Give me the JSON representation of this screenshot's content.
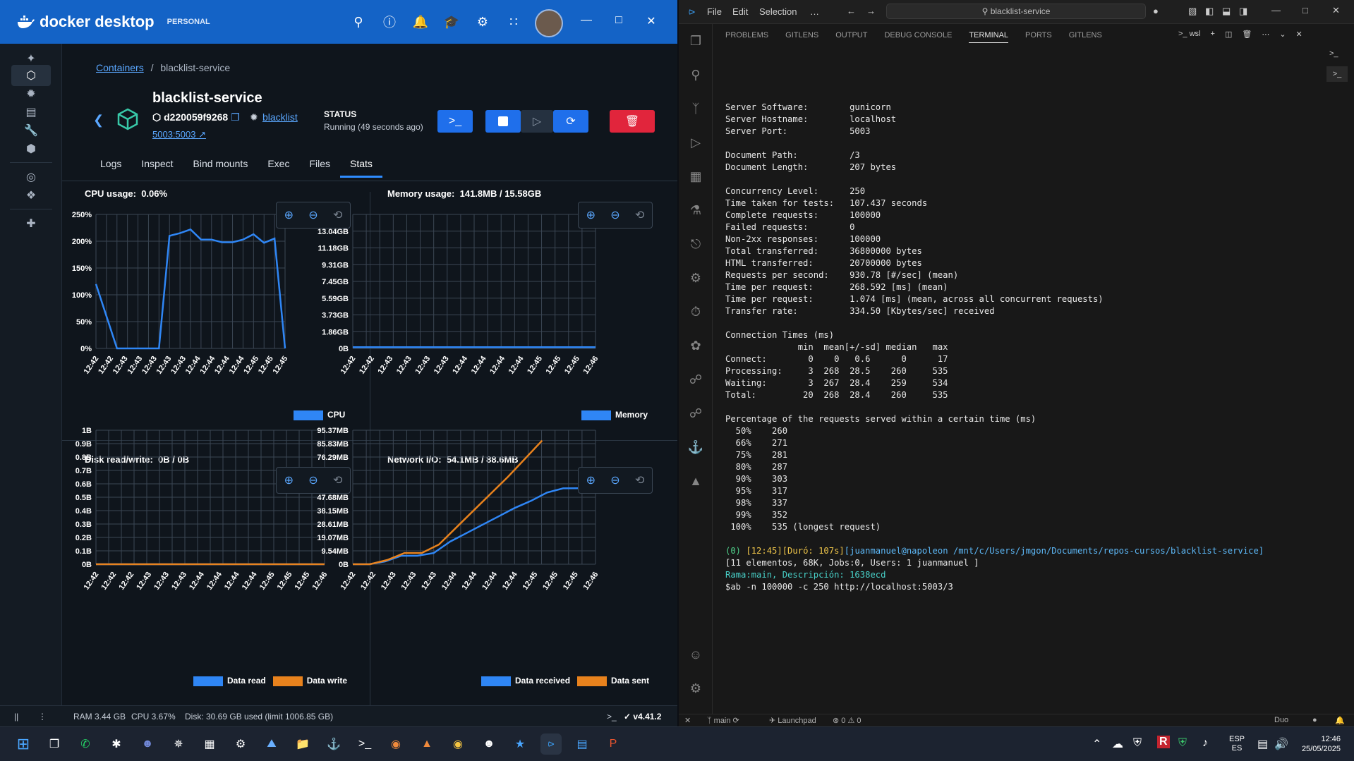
{
  "docker": {
    "app_name": "docker desktop",
    "plan": "PERSONAL",
    "breadcrumb": {
      "root": "Containers",
      "current": "blacklist-service"
    },
    "container": {
      "name": "blacklist-service",
      "id": "d220059f9268",
      "image": "blacklist",
      "port": "5003:5003",
      "status_label": "STATUS",
      "status_value": "Running (49 seconds ago)"
    },
    "tabs": [
      "Logs",
      "Inspect",
      "Bind mounts",
      "Exec",
      "Files",
      "Stats"
    ],
    "active_tab": "Stats",
    "footer": {
      "ram": "RAM 3.44 GB",
      "cpu": "CPU 3.67%",
      "disk": "Disk: 30.69 GB used (limit 1006.85 GB)",
      "version": "v4.41.2"
    },
    "colors": {
      "brand": "#1463c6",
      "primary": "#1f6feb",
      "danger": "#e1253c",
      "series_blue": "#2f86f5",
      "series_orange": "#e8821d"
    }
  },
  "charts": {
    "cpu": {
      "title": "CPU usage:",
      "value": "0.06%"
    },
    "mem": {
      "title": "Memory usage:",
      "value": "141.8MB / 15.58GB"
    },
    "disk": {
      "title": "Disk read/write:",
      "value": "0B / 0B"
    },
    "net": {
      "title": "Network I/O:",
      "value": "54.1MB / 88.6MB"
    }
  },
  "chart_data": [
    {
      "type": "line",
      "title": "CPU usage",
      "y_ticks": [
        "250%",
        "200%",
        "150%",
        "100%",
        "50%",
        "0%"
      ],
      "ylim": [
        0,
        250
      ],
      "x_ticks": [
        "12:42",
        "12:42",
        "12:43",
        "12:43",
        "12:43",
        "12:43",
        "12:43",
        "12:44",
        "12:44",
        "12:44",
        "12:44",
        "12:45",
        "12:45",
        "12:45"
      ],
      "series": [
        {
          "name": "CPU",
          "values": [
            120,
            60,
            0,
            0,
            0,
            0,
            0,
            210,
            215,
            222,
            203,
            203,
            198,
            198,
            203,
            213,
            197,
            205,
            0
          ]
        }
      ],
      "legend": "bottom-right"
    },
    {
      "type": "line",
      "title": "Memory usage",
      "y_ticks": [
        "15.58GB",
        "13.04GB",
        "11.18GB",
        "9.31GB",
        "7.45GB",
        "5.59GB",
        "3.73GB",
        "1.86GB",
        "0B"
      ],
      "x_ticks": [
        "12:42",
        "12:42",
        "12:43",
        "12:43",
        "12:43",
        "12:43",
        "12:44",
        "12:44",
        "12:44",
        "12:44",
        "12:45",
        "12:45",
        "12:45",
        "12:46"
      ],
      "series": [
        {
          "name": "Memory",
          "values": [
            0.14,
            0.14,
            0.14,
            0.14,
            0.14,
            0.14,
            0.14,
            0.14,
            0.14,
            0.14,
            0.14,
            0.14,
            0.14,
            0.14
          ]
        }
      ],
      "legend": "bottom-right"
    },
    {
      "type": "line",
      "title": "Disk read/write",
      "y_ticks": [
        "1B",
        "0.9B",
        "0.8B",
        "0.7B",
        "0.6B",
        "0.5B",
        "0.4B",
        "0.3B",
        "0.2B",
        "0.1B",
        "0B"
      ],
      "x_ticks": [
        "12:42",
        "12:42",
        "12:42",
        "12:43",
        "12:43",
        "12:43",
        "12:44",
        "12:44",
        "12:44",
        "12:44",
        "12:45",
        "12:45",
        "12:45",
        "12:46"
      ],
      "series": [
        {
          "name": "Data read",
          "values": [
            0,
            0,
            0,
            0,
            0,
            0,
            0,
            0,
            0,
            0,
            0,
            0,
            0,
            0
          ]
        },
        {
          "name": "Data write",
          "values": [
            0,
            0,
            0,
            0,
            0,
            0,
            0,
            0,
            0,
            0,
            0,
            0,
            0,
            0
          ]
        }
      ],
      "legend": "bottom-right"
    },
    {
      "type": "line",
      "title": "Network I/O",
      "y_ticks": [
        "95.37MB",
        "85.83MB",
        "76.29MB",
        "66.76MB",
        "57.22MB",
        "47.68MB",
        "38.15MB",
        "28.61MB",
        "19.07MB",
        "9.54MB",
        "0B"
      ],
      "x_ticks": [
        "12:42",
        "12:42",
        "12:43",
        "12:43",
        "12:43",
        "12:44",
        "12:44",
        "12:44",
        "12:44",
        "12:45",
        "12:45",
        "12:45",
        "12:46"
      ],
      "series": [
        {
          "name": "Data received",
          "values": [
            0,
            0,
            2,
            6,
            6,
            8,
            16,
            22,
            28,
            34,
            40,
            45,
            51,
            54,
            54.1,
            54.1
          ]
        },
        {
          "name": "Data sent",
          "values": [
            0,
            0,
            3,
            8,
            8,
            14,
            26,
            38,
            50,
            62,
            75,
            88
          ]
        }
      ],
      "legend": "bottom-right"
    }
  ],
  "vscode": {
    "menu": [
      "File",
      "Edit",
      "Selection",
      "…"
    ],
    "search": "blacklist-service",
    "panel_tabs": [
      "PROBLEMS",
      "GITLENS",
      "OUTPUT",
      "DEBUG CONSOLE",
      "TERMINAL",
      "PORTS",
      "GITLENS"
    ],
    "active_panel_tab": "TERMINAL",
    "terminal_profile": "wsl",
    "terminal_lines": [
      "Server Software:        gunicorn",
      "Server Hostname:        localhost",
      "Server Port:            5003",
      "",
      "Document Path:          /3",
      "Document Length:        207 bytes",
      "",
      "Concurrency Level:      250",
      "Time taken for tests:   107.437 seconds",
      "Complete requests:      100000",
      "Failed requests:        0",
      "Non-2xx responses:      100000",
      "Total transferred:      36800000 bytes",
      "HTML transferred:       20700000 bytes",
      "Requests per second:    930.78 [#/sec] (mean)",
      "Time per request:       268.592 [ms] (mean)",
      "Time per request:       1.074 [ms] (mean, across all concurrent requests)",
      "Transfer rate:          334.50 [Kbytes/sec] received",
      "",
      "Connection Times (ms)",
      "              min  mean[+/-sd] median   max",
      "Connect:        0    0   0.6      0      17",
      "Processing:     3  268  28.5    260     535",
      "Waiting:        3  267  28.4    259     534",
      "Total:         20  268  28.4    260     535",
      "",
      "Percentage of the requests served within a certain time (ms)",
      "  50%    260",
      "  66%    271",
      "  75%    281",
      "  80%    287",
      "  90%    303",
      "  95%    317",
      "  98%    337",
      "  99%    352",
      " 100%    535 (longest request)",
      ""
    ],
    "prompt_line1_a": "(0) ",
    "prompt_line1_b": "[12:45][Duró: 107s]",
    "prompt_line1_c": "[juanmanuel@napoleon /mnt/c/Users/jmgon/Documents/repos-cursos/blacklist-service]",
    "prompt_line2": "[11 elementos, 68K, Jobs:0, Users: 1 juanmanuel ]",
    "prompt_line3": "Rama:main, Descripción: 1638ecd",
    "prompt_line4": "$ab -n 100000 -c 250 http://localhost:5003/3",
    "status": {
      "branch": "main",
      "launchpad": "Launchpad",
      "problems": "0",
      "warnings": "0",
      "duo": "Duo"
    }
  },
  "taskbar": {
    "lang": "ESP",
    "lang2": "ES",
    "time": "12:46",
    "date": "25/05/2025"
  }
}
